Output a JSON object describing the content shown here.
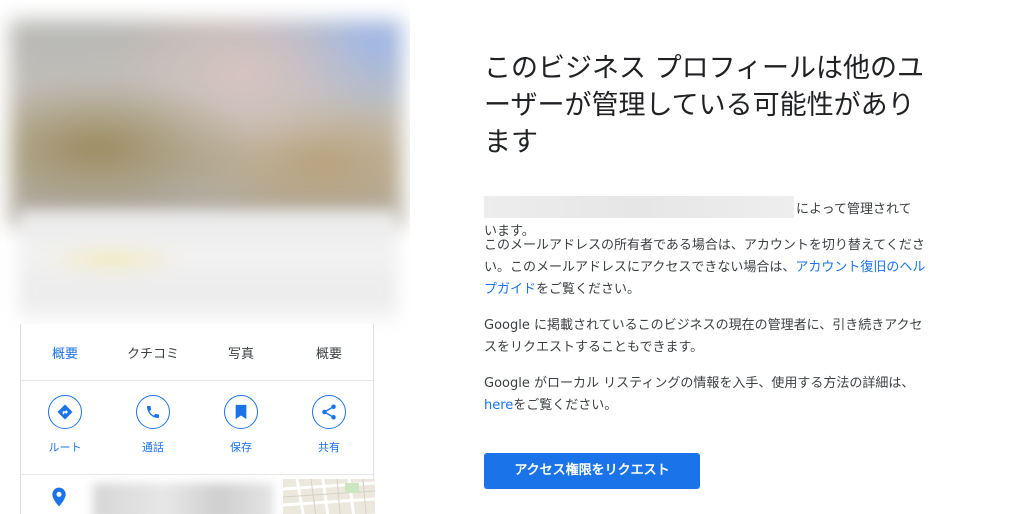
{
  "preview": {
    "tabs": [
      {
        "label": "概要",
        "active": true
      },
      {
        "label": "クチコミ",
        "active": false
      },
      {
        "label": "写真",
        "active": false
      },
      {
        "label": "概要",
        "active": false
      }
    ],
    "actions": [
      {
        "label": "ルート",
        "icon": "directions-icon"
      },
      {
        "label": "通話",
        "icon": "phone-icon"
      },
      {
        "label": "保存",
        "icon": "bookmark-icon"
      },
      {
        "label": "共有",
        "icon": "share-icon"
      }
    ],
    "pin_icon": "location-pin-icon"
  },
  "content": {
    "title": "このビジネス プロフィールは他のユーザーが管理している可能性があります",
    "managed_suffix": "によって管理されて",
    "managed_line2": "います。",
    "para1_text": "このメールアドレスの所有者である場合は、アカウントを切り替えてください。このメールアドレスにアクセスできない場合は、",
    "para1_link": "アカウント復旧のヘルプガイド",
    "para1_end": "をご覧ください。",
    "para2": "Google に掲載されているこのビジネスの現在の管理者に、引き続きアクセスをリクエストすることもできます。",
    "para3_text": "Google がローカル リスティングの情報を入手、使用する方法の詳細は、",
    "para3_link": "here",
    "para3_end": "をご覧ください。",
    "button_label": "アクセス権限をリクエスト"
  },
  "colors": {
    "accent": "#1a73e8",
    "text": "#3c4043",
    "title": "#202124"
  }
}
